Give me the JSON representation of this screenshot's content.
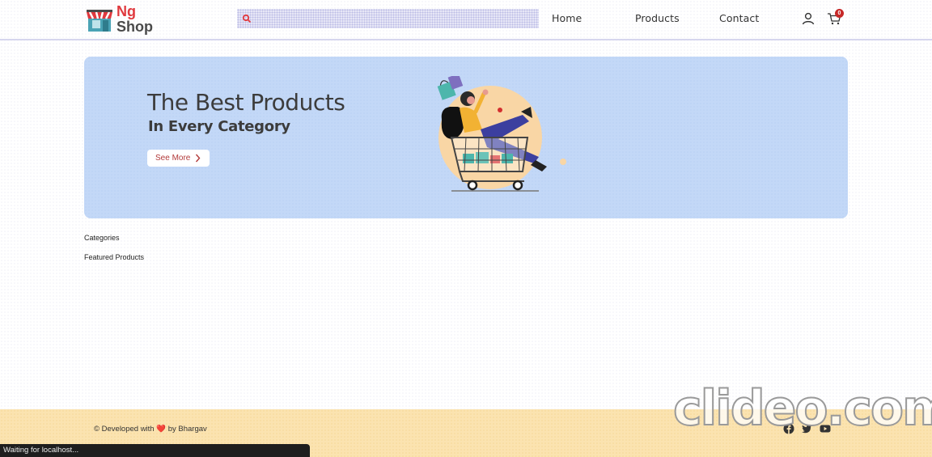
{
  "header": {
    "logo": {
      "line1": "Ng",
      "line2": "Shop"
    },
    "search": {
      "placeholder": "",
      "value": "",
      "icon": "search-icon"
    },
    "nav": [
      {
        "label": "Home"
      },
      {
        "label": "Products"
      },
      {
        "label": "Contact"
      }
    ],
    "user_icon": "user-icon",
    "cart": {
      "icon": "cart-icon",
      "count": "0"
    }
  },
  "hero": {
    "title": "The Best Products",
    "subtitle": "In Every Category",
    "cta_label": "See More",
    "cta_icon": "chevron-right-icon"
  },
  "sections": {
    "categories": "Categories",
    "featured": "Featured Products"
  },
  "footer": {
    "prefix": "© Developed with",
    "heart": "❤️",
    "suffix": "by Bhargav",
    "social": [
      "facebook-icon",
      "twitter-icon",
      "youtube-icon"
    ]
  },
  "watermark": "clideo.com",
  "status_bar": "Waiting for localhost...",
  "colors": {
    "brand_red": "#e0393e",
    "hero_bg": "#c3d8f7",
    "footer_bg": "#fbe3b0",
    "badge": "#c62828"
  }
}
